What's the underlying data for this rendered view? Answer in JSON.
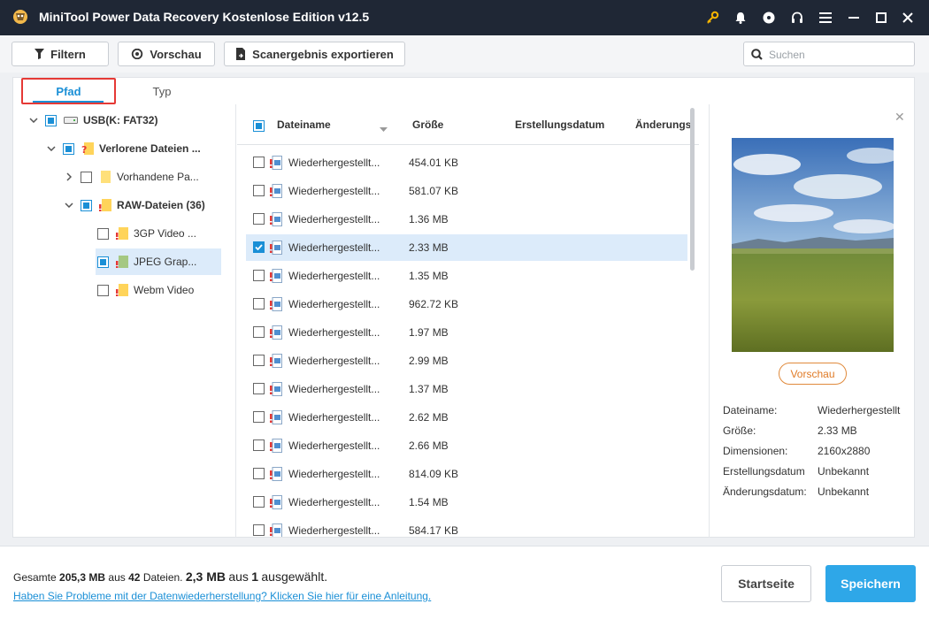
{
  "window": {
    "title": "MiniTool Power Data Recovery Kostenlose Edition v12.5",
    "icons": [
      "key-icon",
      "bell-icon",
      "disc-icon",
      "headphones-icon",
      "menu-icon",
      "minimize-icon",
      "maximize-icon",
      "close-icon"
    ]
  },
  "toolbar": {
    "filter_label": "Filtern",
    "preview_label": "Vorschau",
    "export_label": "Scanergebnis exportieren",
    "search_placeholder": "Suchen"
  },
  "tabs": [
    {
      "label": "Pfad",
      "active": true
    },
    {
      "label": "Typ",
      "active": false
    }
  ],
  "tree": [
    {
      "label": "USB(K: FAT32)",
      "expanded": true,
      "check": "partial",
      "icon": "drive-icon"
    },
    {
      "label": "Verlorene Dateien ...",
      "expanded": true,
      "check": "partial",
      "icon": "lost-folder-icon"
    },
    {
      "label": "Vorhandene Pa...",
      "expanded": false,
      "check": "none",
      "icon": "folder-icon"
    },
    {
      "label": "RAW-Dateien (36)",
      "expanded": true,
      "check": "partial",
      "icon": "raw-folder-icon"
    },
    {
      "label": "3GP Video ...",
      "check": "none",
      "icon": "raw-folder-icon"
    },
    {
      "label": "JPEG Grap...",
      "check": "partial",
      "icon": "image-folder-icon",
      "selected": true
    },
    {
      "label": "Webm Video",
      "check": "none",
      "icon": "raw-folder-icon"
    }
  ],
  "list": {
    "columns": [
      "Dateiname",
      "Größe",
      "Erstellungsdatum",
      "Änderungs"
    ],
    "rows": [
      {
        "name": "Wiederhergestellt...",
        "size": "454.01 KB",
        "checked": false
      },
      {
        "name": "Wiederhergestellt...",
        "size": "581.07 KB",
        "checked": false
      },
      {
        "name": "Wiederhergestellt...",
        "size": "1.36 MB",
        "checked": false
      },
      {
        "name": "Wiederhergestellt...",
        "size": "2.33 MB",
        "checked": true
      },
      {
        "name": "Wiederhergestellt...",
        "size": "1.35 MB",
        "checked": false
      },
      {
        "name": "Wiederhergestellt...",
        "size": "962.72 KB",
        "checked": false
      },
      {
        "name": "Wiederhergestellt...",
        "size": "1.97 MB",
        "checked": false
      },
      {
        "name": "Wiederhergestellt...",
        "size": "2.99 MB",
        "checked": false
      },
      {
        "name": "Wiederhergestellt...",
        "size": "1.37 MB",
        "checked": false
      },
      {
        "name": "Wiederhergestellt...",
        "size": "2.62 MB",
        "checked": false
      },
      {
        "name": "Wiederhergestellt...",
        "size": "2.66 MB",
        "checked": false
      },
      {
        "name": "Wiederhergestellt...",
        "size": "814.09 KB",
        "checked": false
      },
      {
        "name": "Wiederhergestellt...",
        "size": "1.54 MB",
        "checked": false
      },
      {
        "name": "Wiederhergestellt...",
        "size": "584.17 KB",
        "checked": false
      }
    ]
  },
  "preview": {
    "button_label": "Vorschau",
    "meta": [
      {
        "key": "Dateiname:",
        "value": "Wiederhergestellt"
      },
      {
        "key": "Größe:",
        "value": "2.33 MB"
      },
      {
        "key": "Dimensionen:",
        "value": "2160x2880"
      },
      {
        "key": "Erstellungsdatum",
        "value": "Unbekannt"
      },
      {
        "key": "Änderungsdatum:",
        "value": "Unbekannt"
      }
    ]
  },
  "footer": {
    "summary_prefix": "Gesamte",
    "total_size": "205,3 MB",
    "summary_mid": "aus",
    "total_files": "42",
    "summary_files": "Dateien.",
    "selected_size": "2,3 MB",
    "selected_mid": "aus",
    "selected_count": "1",
    "selected_suffix": "ausgewählt.",
    "help_link": "Haben Sie Probleme mit der Datenwiederherstellung? Klicken Sie hier für eine Anleitung.",
    "home_label": "Startseite",
    "save_label": "Speichern"
  },
  "colors": {
    "accent": "#1a8fd6",
    "titlebar": "#1f2735",
    "save_button": "#2ea7e8",
    "highlight_box": "#e53935"
  }
}
